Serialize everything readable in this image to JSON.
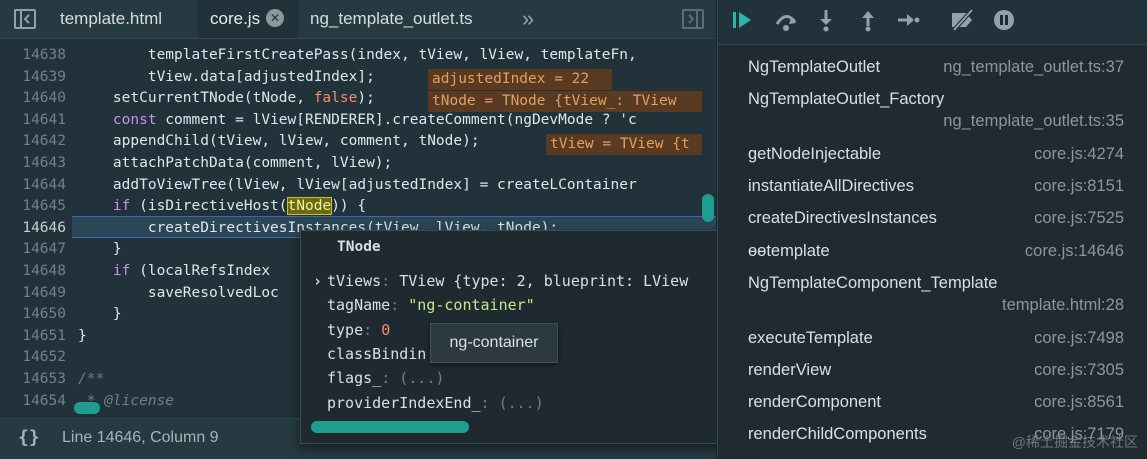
{
  "tabs": [
    {
      "label": "template.html",
      "active": false
    },
    {
      "label": "core.js",
      "active": true
    },
    {
      "label": "ng_template_outlet.ts",
      "active": false
    }
  ],
  "tab_overflow": "»",
  "tab_close_glyph": "✕",
  "icons": {
    "toggle_left_panel": "panel-left-icon",
    "toggle_right_panel": "panel-right-icon",
    "overflow": "chevrons-right-icon"
  },
  "code_lines": [
    {
      "num": "14638",
      "text": "        templateFirstCreatePass(index, tView, lView, templateFn,"
    },
    {
      "num": "14639",
      "text": "        tView.data[adjustedIndex];"
    },
    {
      "num": "14640",
      "text": "    setCurrentTNode(tNode, false);"
    },
    {
      "num": "14641",
      "text": "    const comment = lView[RENDERER].createComment(ngDevMode ? 'c"
    },
    {
      "num": "14642",
      "text": "    appendChild(tView, lView, comment, tNode);"
    },
    {
      "num": "14643",
      "text": "    attachPatchData(comment, lView);"
    },
    {
      "num": "14644",
      "text": "    addToViewTree(lView, lView[adjustedIndex] = createLContainer"
    },
    {
      "num": "14645",
      "text": "    if (isDirectiveHost(tNode)) {"
    },
    {
      "num": "14646",
      "text": "        createDirectivesInstances(tView, lView, tNode);"
    },
    {
      "num": "14647",
      "text": "    }"
    },
    {
      "num": "14648",
      "text": "    if (localRefsIndex"
    },
    {
      "num": "14649",
      "text": "        saveResolvedLoc"
    },
    {
      "num": "14650",
      "text": "    }"
    },
    {
      "num": "14651",
      "text": "}"
    },
    {
      "num": "14652",
      "text": ""
    },
    {
      "num": "14653",
      "text": "/**"
    },
    {
      "num": "14654",
      "text": " * @license"
    }
  ],
  "inline_hints": {
    "h1": "adjustedIndex = 22",
    "h2": "tNode = TNode {tView_: TView",
    "h3": "tView = TView {t"
  },
  "status": {
    "cursor": "Line 14646, Column 9",
    "braces_icon": "{}"
  },
  "popup": {
    "title": "TNode",
    "props": [
      {
        "key": "tViews",
        "sep": ": ",
        "val": "TView {type: 2, blueprint: LView",
        "kind": "type",
        "expandable": true
      },
      {
        "key": "tagName",
        "sep": ": ",
        "val": "\"ng-container\"",
        "kind": "str",
        "expandable": false
      },
      {
        "key": "type",
        "sep": ": ",
        "val": "0",
        "kind": "num",
        "expandable": false
      },
      {
        "key": "classBindin",
        "sep": "",
        "val": "",
        "kind": "dim",
        "expandable": false
      },
      {
        "key": "flags_",
        "sep": ": ",
        "val": "(...)",
        "kind": "dim",
        "expandable": false
      },
      {
        "key": "providerIndexEnd_",
        "sep": ": ",
        "val": "(...)",
        "kind": "dim",
        "expandable": false
      }
    ],
    "tooltip": "ng-container"
  },
  "call_stack": [
    {
      "name": "NgTemplateOutlet",
      "location": "ng_template_outlet.ts:37"
    },
    {
      "name": "NgTemplateOutlet_Factory",
      "location": "ng_template_outlet.ts:35"
    },
    {
      "name": "getNodeInjectable",
      "location": "core.js:4274"
    },
    {
      "name": "instantiateAllDirectives",
      "location": "core.js:8151"
    },
    {
      "name": "createDirectivesInstances",
      "location": "core.js:7525"
    },
    {
      "name": "ɵɵtemplate",
      "location": "core.js:14646"
    },
    {
      "name": "NgTemplateComponent_Template",
      "location": "template.html:28"
    },
    {
      "name": "executeTemplate",
      "location": "core.js:7498"
    },
    {
      "name": "renderView",
      "location": "core.js:7305"
    },
    {
      "name": "renderComponent",
      "location": "core.js:8561"
    },
    {
      "name": "renderChildComponents",
      "location": "core.js:7179"
    }
  ],
  "debug_icons": [
    "resume-icon",
    "step-over-icon",
    "step-into-icon",
    "step-out-icon",
    "step-icon",
    "deactivate-breakpoints-icon",
    "pause-on-exceptions-icon"
  ],
  "watermark": "@稀土掘金技术社区",
  "colors": {
    "accent": "#2ab7a9",
    "hint_bg": "#5a3a20"
  }
}
